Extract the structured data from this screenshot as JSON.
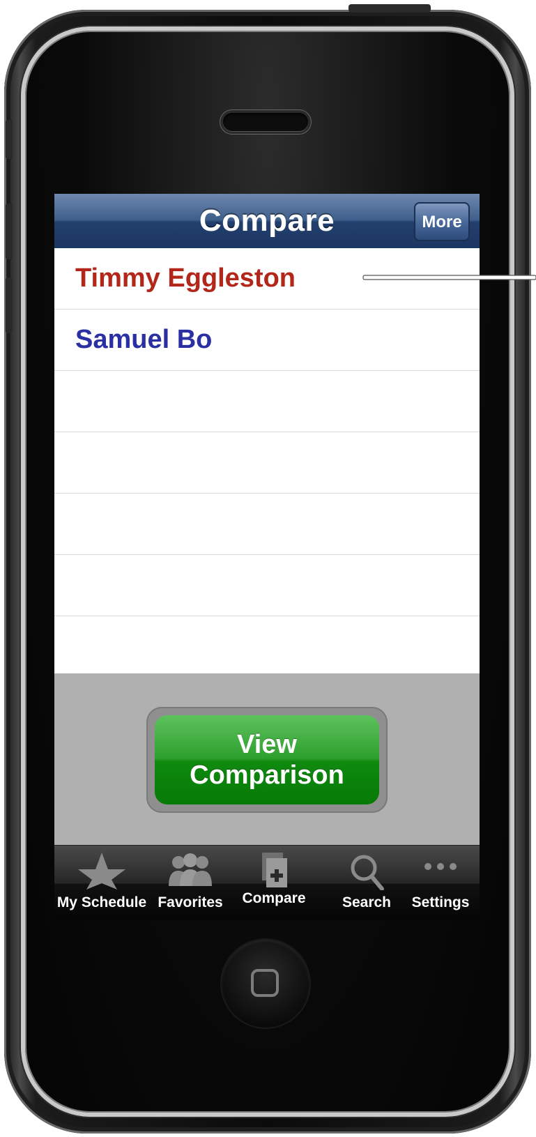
{
  "nav": {
    "title": "Compare",
    "more_label": "More"
  },
  "rows": [
    {
      "label": "Timmy Eggleston",
      "color": "#b3261a"
    },
    {
      "label": "Samuel Bo",
      "color": "#2a2fa3"
    },
    {
      "label": ""
    },
    {
      "label": ""
    },
    {
      "label": ""
    },
    {
      "label": ""
    },
    {
      "label": ""
    }
  ],
  "action": {
    "line1": "View",
    "line2": "Comparison",
    "color": "#1a8f1a"
  },
  "tabs": [
    {
      "label": "My Schedule",
      "icon": "star-icon"
    },
    {
      "label": "Favorites",
      "icon": "people-icon"
    },
    {
      "label": "Compare",
      "icon": "compare-plus-icon"
    },
    {
      "label": "Search",
      "icon": "magnifier-icon"
    },
    {
      "label": "Settings",
      "icon": "more-dots-icon"
    }
  ],
  "colors": {
    "navbar": "#233f6c",
    "tabbar": "#111111",
    "panel": "#b0b0b0"
  }
}
